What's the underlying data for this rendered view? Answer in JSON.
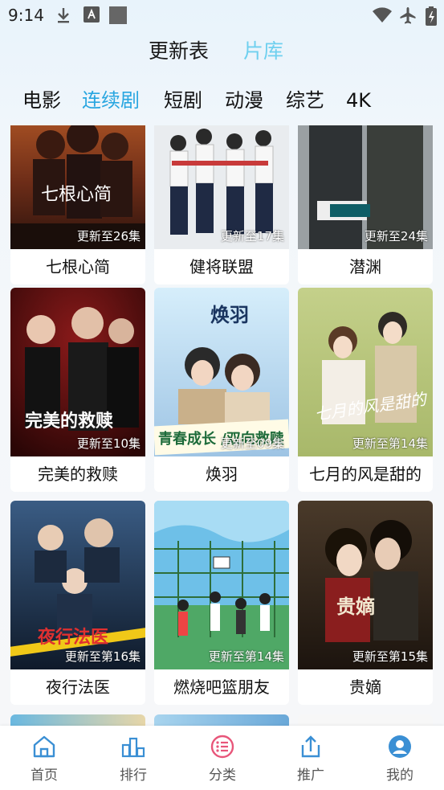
{
  "status_bar": {
    "time": "9:14"
  },
  "top_tabs": [
    {
      "label": "更新表",
      "active": false
    },
    {
      "label": "片库",
      "active": true
    }
  ],
  "categories": [
    {
      "label": "电影",
      "active": false
    },
    {
      "label": "连续剧",
      "active": true
    },
    {
      "label": "短剧",
      "active": false
    },
    {
      "label": "动漫",
      "active": false
    },
    {
      "label": "综艺",
      "active": false
    },
    {
      "label": "4K",
      "active": false
    }
  ],
  "grid": [
    {
      "title": "七根心简",
      "badge": "更新至26集",
      "poster_text": "七根心简"
    },
    {
      "title": "健将联盟",
      "badge": "更新至17集",
      "poster_text": ""
    },
    {
      "title": "潜渊",
      "badge": "更新至24集",
      "poster_text": ""
    },
    {
      "title": "完美的救赎",
      "badge": "更新至10集",
      "poster_text": "完美的救赎"
    },
    {
      "title": "焕羽",
      "badge": "更新至09集",
      "poster_text": "青春成长 /双向救赎"
    },
    {
      "title": "七月的风是甜的",
      "badge": "更新至第14集",
      "poster_text": "七月的风是甜的"
    },
    {
      "title": "夜行法医",
      "badge": "更新至第16集",
      "poster_text": "夜行法医"
    },
    {
      "title": "燃烧吧篮朋友",
      "badge": "更新至第14集",
      "poster_text": ""
    },
    {
      "title": "贵嫡",
      "badge": "更新至第15集",
      "poster_text": "贵嫡"
    }
  ],
  "bottom_nav": [
    {
      "label": "首页",
      "icon": "home-icon"
    },
    {
      "label": "排行",
      "icon": "ranking-icon"
    },
    {
      "label": "分类",
      "icon": "category-icon",
      "active": true
    },
    {
      "label": "推广",
      "icon": "share-icon"
    },
    {
      "label": "我的",
      "icon": "profile-icon"
    }
  ],
  "colors": {
    "accent": "#29a6e0",
    "tab_active": "#6fd0ef",
    "category_icon": "#e8567a",
    "nav_icon": "#3a8fd4"
  }
}
